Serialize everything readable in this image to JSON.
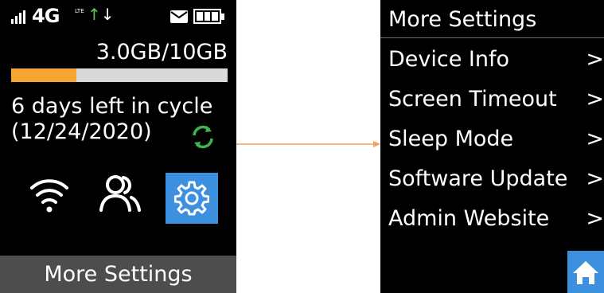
{
  "left_screen": {
    "status": {
      "network": "4G",
      "network_sub": "LTE",
      "signal_bars": 4
    },
    "usage_text": "3.0GB/10GB",
    "usage_fraction": 0.3,
    "cycle_text": "6 days left in cycle",
    "date_text": "(12/24/2020)",
    "bottom_label": "More Settings",
    "icons": [
      "wifi-icon",
      "users-icon",
      "gear-icon",
      "refresh-icon",
      "mail-icon",
      "battery-icon"
    ]
  },
  "right_screen": {
    "title": "More Settings",
    "items": [
      {
        "label": "Device Info",
        "chevron": ">"
      },
      {
        "label": "Screen Timeout",
        "chevron": ">"
      },
      {
        "label": "Sleep Mode",
        "chevron": ">"
      },
      {
        "label": "Software Update",
        "chevron": ">"
      },
      {
        "label": "Admin Website",
        "chevron": ">"
      }
    ],
    "icons": [
      "home-icon"
    ]
  },
  "colors": {
    "accent_blue": "#3d8fe0",
    "usage_orange": "#f7a532",
    "refresh_green": "#3fb34f",
    "arrow_orange": "#f0a060",
    "bottom_bar_gray": "#4d4d4d"
  }
}
